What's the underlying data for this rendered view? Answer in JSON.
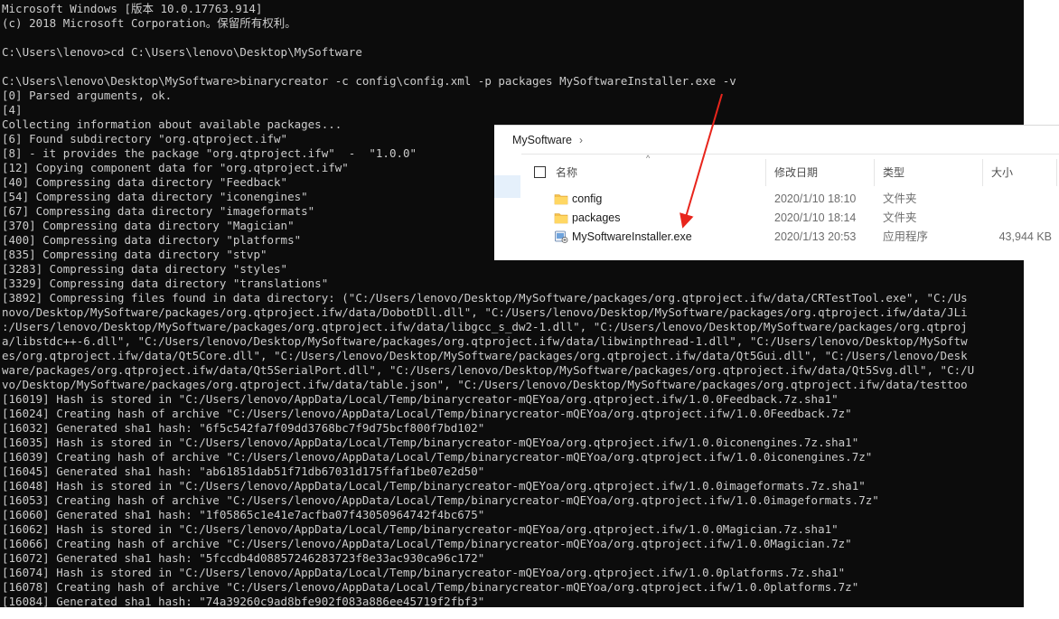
{
  "console": {
    "lines": [
      "Microsoft Windows [版本 10.0.17763.914]",
      "(c) 2018 Microsoft Corporation。保留所有权利。",
      "",
      "C:\\Users\\lenovo>cd C:\\Users\\lenovo\\Desktop\\MySoftware",
      "",
      "C:\\Users\\lenovo\\Desktop\\MySoftware>binarycreator -c config\\config.xml -p packages MySoftwareInstaller.exe -v",
      "[0] Parsed arguments, ok.",
      "[4]",
      "Collecting information about available packages...",
      "[6] Found subdirectory \"org.qtproject.ifw\"",
      "[8] - it provides the package \"org.qtproject.ifw\"  -  \"1.0.0\"",
      "[12] Copying component data for \"org.qtproject.ifw\"",
      "[40] Compressing data directory \"Feedback\"",
      "[54] Compressing data directory \"iconengines\"",
      "[67] Compressing data directory \"imageformats\"",
      "[370] Compressing data directory \"Magician\"",
      "[400] Compressing data directory \"platforms\"",
      "[835] Compressing data directory \"stvp\"",
      "[3283] Compressing data directory \"styles\"",
      "[3329] Compressing data directory \"translations\"",
      "[3892] Compressing files found in data directory: (\"C:/Users/lenovo/Desktop/MySoftware/packages/org.qtproject.ifw/data/CRTestTool.exe\", \"C:/Us",
      "novo/Desktop/MySoftware/packages/org.qtproject.ifw/data/DobotDll.dll\", \"C:/Users/lenovo/Desktop/MySoftware/packages/org.qtproject.ifw/data/JLi",
      ":/Users/lenovo/Desktop/MySoftware/packages/org.qtproject.ifw/data/libgcc_s_dw2-1.dll\", \"C:/Users/lenovo/Desktop/MySoftware/packages/org.qtproj",
      "a/libstdc++-6.dll\", \"C:/Users/lenovo/Desktop/MySoftware/packages/org.qtproject.ifw/data/libwinpthread-1.dll\", \"C:/Users/lenovo/Desktop/MySoftw",
      "es/org.qtproject.ifw/data/Qt5Core.dll\", \"C:/Users/lenovo/Desktop/MySoftware/packages/org.qtproject.ifw/data/Qt5Gui.dll\", \"C:/Users/lenovo/Desk",
      "ware/packages/org.qtproject.ifw/data/Qt5SerialPort.dll\", \"C:/Users/lenovo/Desktop/MySoftware/packages/org.qtproject.ifw/data/Qt5Svg.dll\", \"C:/U",
      "vo/Desktop/MySoftware/packages/org.qtproject.ifw/data/table.json\", \"C:/Users/lenovo/Desktop/MySoftware/packages/org.qtproject.ifw/data/testtoo",
      "[16019] Hash is stored in \"C:/Users/lenovo/AppData/Local/Temp/binarycreator-mQEYoa/org.qtproject.ifw/1.0.0Feedback.7z.sha1\"",
      "[16024] Creating hash of archive \"C:/Users/lenovo/AppData/Local/Temp/binarycreator-mQEYoa/org.qtproject.ifw/1.0.0Feedback.7z\"",
      "[16032] Generated sha1 hash: \"6f5c542fa7f09dd3768bc7f9d75bcf800f7bd102\"",
      "[16035] Hash is stored in \"C:/Users/lenovo/AppData/Local/Temp/binarycreator-mQEYoa/org.qtproject.ifw/1.0.0iconengines.7z.sha1\"",
      "[16039] Creating hash of archive \"C:/Users/lenovo/AppData/Local/Temp/binarycreator-mQEYoa/org.qtproject.ifw/1.0.0iconengines.7z\"",
      "[16045] Generated sha1 hash: \"ab61851dab51f71db67031d175ffaf1be07e2d50\"",
      "[16048] Hash is stored in \"C:/Users/lenovo/AppData/Local/Temp/binarycreator-mQEYoa/org.qtproject.ifw/1.0.0imageformats.7z.sha1\"",
      "[16053] Creating hash of archive \"C:/Users/lenovo/AppData/Local/Temp/binarycreator-mQEYoa/org.qtproject.ifw/1.0.0imageformats.7z\"",
      "[16060] Generated sha1 hash: \"1f05865c1e41e7acfba07f43050964742f4bc675\"",
      "[16062] Hash is stored in \"C:/Users/lenovo/AppData/Local/Temp/binarycreator-mQEYoa/org.qtproject.ifw/1.0.0Magician.7z.sha1\"",
      "[16066] Creating hash of archive \"C:/Users/lenovo/AppData/Local/Temp/binarycreator-mQEYoa/org.qtproject.ifw/1.0.0Magician.7z\"",
      "[16072] Generated sha1 hash: \"5fccdb4d08857246283723f8e33ac930ca96c172\"",
      "[16074] Hash is stored in \"C:/Users/lenovo/AppData/Local/Temp/binarycreator-mQEYoa/org.qtproject.ifw/1.0.0platforms.7z.sha1\"",
      "[16078] Creating hash of archive \"C:/Users/lenovo/AppData/Local/Temp/binarycreator-mQEYoa/org.qtproject.ifw/1.0.0platforms.7z\"",
      "[16084] Generated sha1 hash: \"74a39260c9ad8bfe902f083a886ee45719f2fbf3\""
    ],
    "text_color": "#cccccc",
    "background": "#0c0c0c"
  },
  "explorer": {
    "path": "MySoftware",
    "path_chevron": "›",
    "columns": {
      "name": "名称",
      "date": "修改日期",
      "type": "类型",
      "size": "大小"
    },
    "sort_indicator": "^",
    "rows": [
      {
        "icon": "folder-icon",
        "name": "config",
        "date": "2020/1/10 18:10",
        "type": "文件夹",
        "size": ""
      },
      {
        "icon": "folder-icon",
        "name": "packages",
        "date": "2020/1/10 18:14",
        "type": "文件夹",
        "size": ""
      },
      {
        "icon": "installer-exe-icon",
        "name": "MySoftwareInstaller.exe",
        "date": "2020/1/13 20:53",
        "type": "应用程序",
        "size": "43,944 KB"
      }
    ]
  },
  "annotation": {
    "icon": "red-arrow-icon",
    "color": "#e8251c"
  }
}
